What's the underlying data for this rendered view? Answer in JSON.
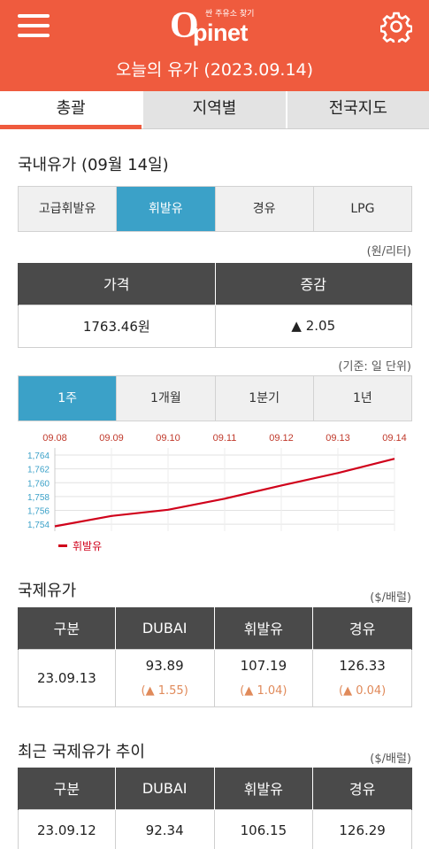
{
  "header": {
    "logo_text": "Opinet",
    "logo_tagline": "싼 주유소 찾기",
    "title": "오늘의 유가 (2023.09.14)",
    "icons": {
      "menu": "hamburger-menu-icon",
      "settings": "gear-icon"
    },
    "accent_color": "#ef5b3e"
  },
  "tabs": [
    {
      "label": "총괄",
      "active": true
    },
    {
      "label": "지역별",
      "active": false
    },
    {
      "label": "전국지도",
      "active": false
    }
  ],
  "domestic": {
    "title": "국내유가 (09월 14일)",
    "fuel_types": [
      {
        "label": "고급휘발유",
        "active": false
      },
      {
        "label": "휘발유",
        "active": true
      },
      {
        "label": "경유",
        "active": false
      },
      {
        "label": "LPG",
        "active": false
      }
    ],
    "unit": "(원/리터)",
    "price_header": "가격",
    "change_header": "증감",
    "price": "1763.46원",
    "change": "▲ 2.05",
    "basis": "(기준: 일 단위)",
    "periods": [
      {
        "label": "1주",
        "active": true
      },
      {
        "label": "1개월",
        "active": false
      },
      {
        "label": "1분기",
        "active": false
      },
      {
        "label": "1년",
        "active": false
      }
    ],
    "active_color": "#3ba1c8"
  },
  "chart_data": {
    "type": "line",
    "x": [
      "09.08",
      "09.09",
      "09.10",
      "09.11",
      "09.12",
      "09.13",
      "09.14"
    ],
    "series": [
      {
        "name": "휘발유",
        "values": [
          1753.7,
          1755.2,
          1756.1,
          1757.7,
          1759.6,
          1761.4,
          1763.46
        ],
        "color": "#d0021b"
      }
    ],
    "y_ticks": [
      "1,754",
      "1,756",
      "1,758",
      "1,760",
      "1,762",
      "1,764"
    ],
    "ylim": [
      1753,
      1764
    ],
    "grid": true,
    "legend": "bottom-left",
    "title": "",
    "xlabel": "",
    "ylabel": ""
  },
  "international": {
    "title": "국제유가",
    "unit": "($/배럴)",
    "headers": [
      "구분",
      "DUBAI",
      "휘발유",
      "경유"
    ],
    "row": {
      "date": "23.09.13",
      "values": [
        "93.89",
        "107.19",
        "126.33"
      ],
      "changes": [
        "(▲ 1.55)",
        "(▲ 1.04)",
        "(▲ 0.04)"
      ]
    }
  },
  "trend": {
    "title": "최근 국제유가 추이",
    "unit": "($/배럴)",
    "headers": [
      "구분",
      "DUBAI",
      "휘발유",
      "경유"
    ],
    "rows": [
      [
        "23.09.12",
        "92.34",
        "106.15",
        "126.29"
      ]
    ]
  }
}
